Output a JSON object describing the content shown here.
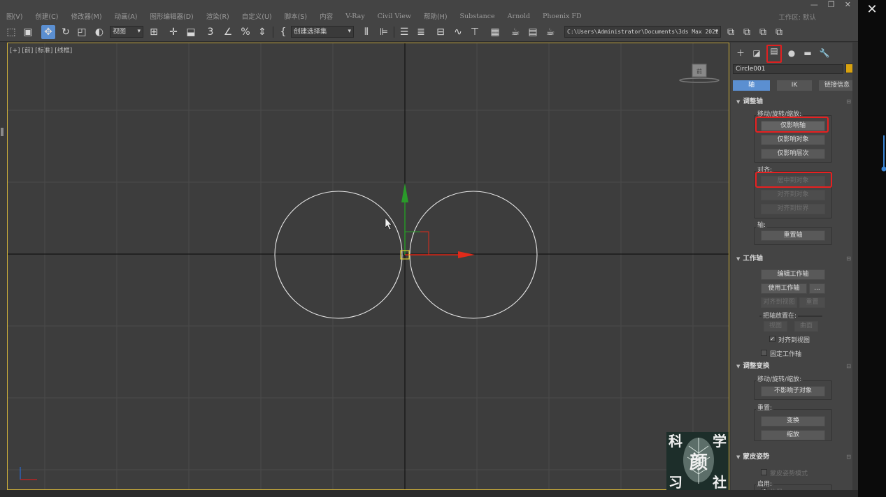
{
  "menu": [
    "图(V)",
    "创建(C)",
    "修改器(M)",
    "动画(A)",
    "图形编辑器(D)",
    "渲染(R)",
    "自定义(U)",
    "脚本(S)",
    "内容",
    "V-Ray",
    "Civil View",
    "帮助(H)",
    "Substance",
    "Arnold",
    "Phoenix FD"
  ],
  "workspace_label": "工作区: 默认",
  "toolbar": {
    "view_dropdown": "视图",
    "selection_set_dropdown": "创建选择集",
    "path_dropdown": "C:\\Users\\Administrator\\Documents\\3ds Max 2022"
  },
  "viewport": {
    "label": "[+] [前] [标准] [线框]"
  },
  "panel": {
    "object_name": "Circle001",
    "object_color": "#d8a20f",
    "subtabs": [
      "轴",
      "IK",
      "链接信息"
    ],
    "adjust_pivot": {
      "title": "调整轴",
      "move_group_label": "移动/旋转/缩放:",
      "affect_pivot_only": "仅影响轴",
      "affect_object_only": "仅影响对象",
      "affect_hierarchy_only": "仅影响层次",
      "align_label": "对齐:",
      "center_to_object": "居中到对象",
      "align_to_object": "对齐到对象",
      "align_to_world": "对齐到世界",
      "pivot_label": "轴:",
      "reset_pivot": "重置轴"
    },
    "working_pivot": {
      "title": "工作轴",
      "edit_working_pivot": "编辑工作轴",
      "use_working_pivot": "使用工作轴",
      "ellipsis": "...",
      "align_to_view": "对齐到视图",
      "reset": "重置",
      "place_pivot_label": "把轴放置在:",
      "view": "视图",
      "surface": "曲面",
      "align_to_view_check": "对齐到视图",
      "lock_working_pivot": "固定工作轴"
    },
    "adjust_transform": {
      "title": "调整变换",
      "move_group_label": "移动/旋转/缩放:",
      "dont_affect_children": "不影响子对象",
      "reset_label": "重置:",
      "transform": "变换",
      "scale": "缩放"
    },
    "skin_pose": {
      "title": "蒙皮姿势",
      "skin_pose_mode": "蒙皮姿势模式",
      "enabled_label": "启用:",
      "position": "位置"
    }
  },
  "logo_chars": [
    "科",
    "学",
    "颜",
    "习",
    "社"
  ],
  "colors": {
    "accent_blue": "#5b8fd1",
    "highlight_red": "#e82020",
    "circle_stroke": "#e6e6e6",
    "gizmo_x": "#e02a1a",
    "gizmo_y": "#2a9a2a"
  }
}
